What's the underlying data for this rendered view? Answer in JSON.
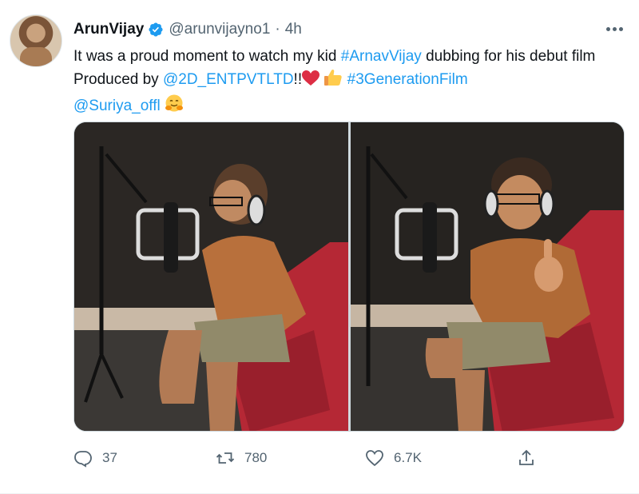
{
  "tweet": {
    "author_name": "ArunVijay",
    "handle": "@arunvijayno1",
    "separator": "·",
    "time": "4h",
    "text_segments": [
      {
        "text": "It was a proud moment to watch my kid ",
        "type": "plain"
      },
      {
        "text": "#ArnavVijay",
        "type": "link"
      },
      {
        "text": " dubbing for his debut film Produced by ",
        "type": "plain"
      },
      {
        "text": "@2D_ENTPVTLTD",
        "type": "link"
      },
      {
        "text": "!!",
        "type": "plain"
      }
    ],
    "hashtag_generation": "#3GenerationFilm",
    "mention_suriya": "@Suriya_offl",
    "emojis": [
      "red-heart-emoji",
      "thumbs-up-emoji",
      "hugging-face-emoji"
    ],
    "photos": [
      "photo-boy-at-mic-side",
      "photo-boy-thumbs-up"
    ],
    "actions": {
      "reply_count": "37",
      "retweet_count": "780",
      "like_count": "6.7K",
      "share_label": ""
    }
  },
  "colors": {
    "link": "#1d9bf0",
    "secondary_text": "#536471",
    "verified_badge": "#1d9bf0"
  },
  "icons": [
    "more-options-icon",
    "verified-badge-icon",
    "reply-icon",
    "retweet-icon",
    "like-icon",
    "share-icon"
  ]
}
